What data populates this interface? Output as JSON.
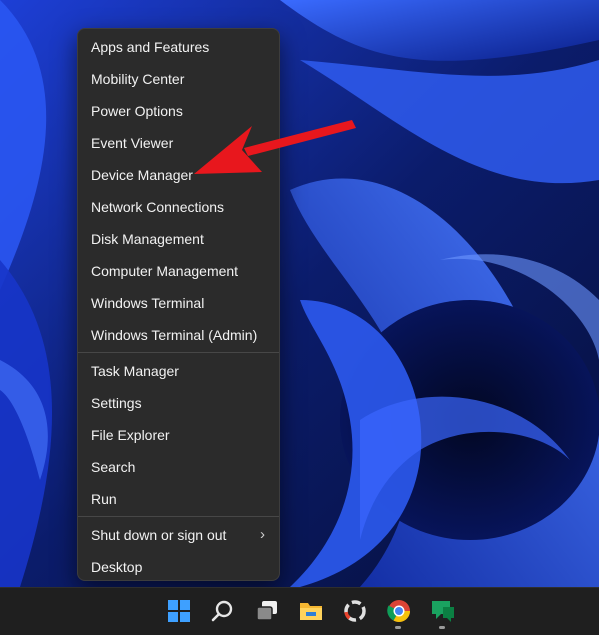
{
  "context_menu": {
    "group1": [
      "Apps and Features",
      "Mobility Center",
      "Power Options",
      "Event Viewer",
      "Device Manager",
      "Network Connections",
      "Disk Management",
      "Computer Management",
      "Windows Terminal",
      "Windows Terminal (Admin)"
    ],
    "group2": [
      "Task Manager",
      "Settings",
      "File Explorer",
      "Search",
      "Run"
    ],
    "group3": [
      "Shut down or sign out",
      "Desktop"
    ]
  },
  "annotation": {
    "arrow_color": "#e8171d",
    "target": "Device Manager"
  },
  "taskbar": {
    "icons": [
      "windows-start-icon",
      "search-icon",
      "task-view-icon",
      "file-explorer-icon",
      "app-icon",
      "chrome-icon",
      "messaging-app-icon"
    ]
  },
  "colors": {
    "menu_background": "#2b2b2b",
    "menu_text": "#f2f2f2",
    "taskbar_background": "#1f1f1f",
    "wallpaper_base": "#0b1a52"
  }
}
